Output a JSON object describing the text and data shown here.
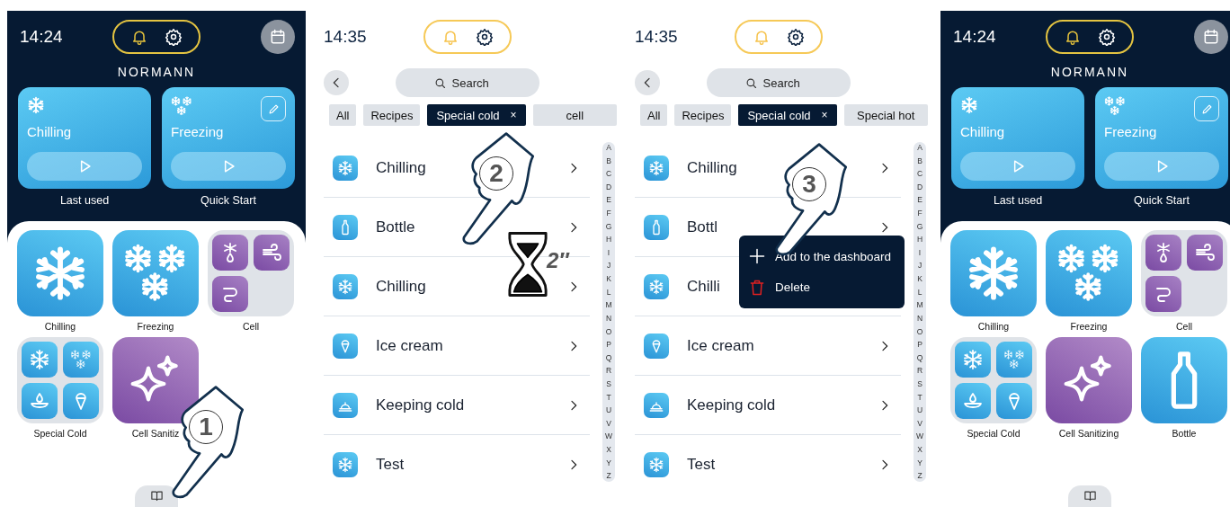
{
  "screens": [
    {
      "kind": "dashboard",
      "time": "14:24",
      "brand": "NORMANN",
      "cards": [
        {
          "kind": "chilling",
          "title": "Chilling",
          "caption": "Last used",
          "editable": false
        },
        {
          "kind": "freezing",
          "title": "Freezing",
          "caption": "Quick Start",
          "editable": true
        }
      ],
      "tiles": [
        {
          "kind": "chilling",
          "label": "Chilling"
        },
        {
          "kind": "freezing",
          "label": "Freezing"
        },
        {
          "kind": "cell",
          "label": "Cell"
        },
        {
          "kind": "special",
          "label": "Special Cold"
        },
        {
          "kind": "sanitizing",
          "label": "Cell Sanitiz"
        }
      ],
      "step": {
        "number": "1"
      }
    },
    {
      "kind": "list",
      "time": "14:35",
      "search": {
        "placeholder": "Search"
      },
      "filters": [
        {
          "label": "All",
          "selected": false
        },
        {
          "label": "Recipes",
          "selected": false
        },
        {
          "label": "Special cold",
          "selected": true,
          "close": "×"
        },
        {
          "label": "cell",
          "selected": false
        }
      ],
      "items": [
        {
          "kind": "snow",
          "label": "Chilling",
          "chevron": true
        },
        {
          "kind": "bottle",
          "label": "Bottle",
          "chevron": true
        },
        {
          "kind": "snow",
          "label": "Chilling",
          "chevron": true
        },
        {
          "kind": "cone",
          "label": "Ice cream",
          "chevron": true
        },
        {
          "kind": "cloche",
          "label": "Keeping cold",
          "chevron": true
        },
        {
          "kind": "snow",
          "label": "Test",
          "chevron": true
        }
      ],
      "index": [
        "A",
        "B",
        "C",
        "D",
        "E",
        "F",
        "G",
        "H",
        "I",
        "J",
        "K",
        "L",
        "M",
        "N",
        "O",
        "P",
        "Q",
        "R",
        "S",
        "T",
        "U",
        "V",
        "W",
        "X",
        "Y",
        "Z"
      ],
      "step": {
        "number": "2",
        "hold": "2″"
      }
    },
    {
      "kind": "list",
      "time": "14:35",
      "search": {
        "placeholder": "Search"
      },
      "filters": [
        {
          "label": "All",
          "selected": false
        },
        {
          "label": "Recipes",
          "selected": false
        },
        {
          "label": "Special cold",
          "selected": true,
          "close": "×"
        },
        {
          "label": "Special hot",
          "selected": false
        }
      ],
      "items": [
        {
          "kind": "snow",
          "label": "Chilling",
          "chevron": true
        },
        {
          "kind": "bottle",
          "label": "Bottl",
          "chevron": true
        },
        {
          "kind": "snow",
          "label": "Chilli",
          "chevron": false
        },
        {
          "kind": "cone",
          "label": "Ice cream",
          "chevron": true
        },
        {
          "kind": "cloche",
          "label": "Keeping cold",
          "chevron": true
        },
        {
          "kind": "snow",
          "label": "Test",
          "chevron": true
        }
      ],
      "index": [
        "A",
        "B",
        "C",
        "D",
        "E",
        "F",
        "G",
        "H",
        "I",
        "J",
        "K",
        "L",
        "M",
        "N",
        "O",
        "P",
        "Q",
        "R",
        "S",
        "T",
        "U",
        "V",
        "W",
        "X",
        "Y",
        "Z"
      ],
      "menu": [
        {
          "kind": "add",
          "label": "Add to the dashboard"
        },
        {
          "kind": "delete",
          "label": "Delete"
        }
      ],
      "step": {
        "number": "3"
      }
    },
    {
      "kind": "dashboard",
      "time": "14:24",
      "brand": "NORMANN",
      "cards": [
        {
          "kind": "chilling",
          "title": "Chilling",
          "caption": "Last used",
          "editable": false
        },
        {
          "kind": "freezing",
          "title": "Freezing",
          "caption": "Quick Start",
          "editable": true
        }
      ],
      "tiles": [
        {
          "kind": "chilling",
          "label": "Chilling"
        },
        {
          "kind": "freezing",
          "label": "Freezing"
        },
        {
          "kind": "cell",
          "label": "Cell"
        },
        {
          "kind": "special",
          "label": "Special Cold"
        },
        {
          "kind": "sanitizing",
          "label": "Cell Sanitizing"
        },
        {
          "kind": "bottle",
          "label": "Bottle"
        }
      ]
    }
  ]
}
